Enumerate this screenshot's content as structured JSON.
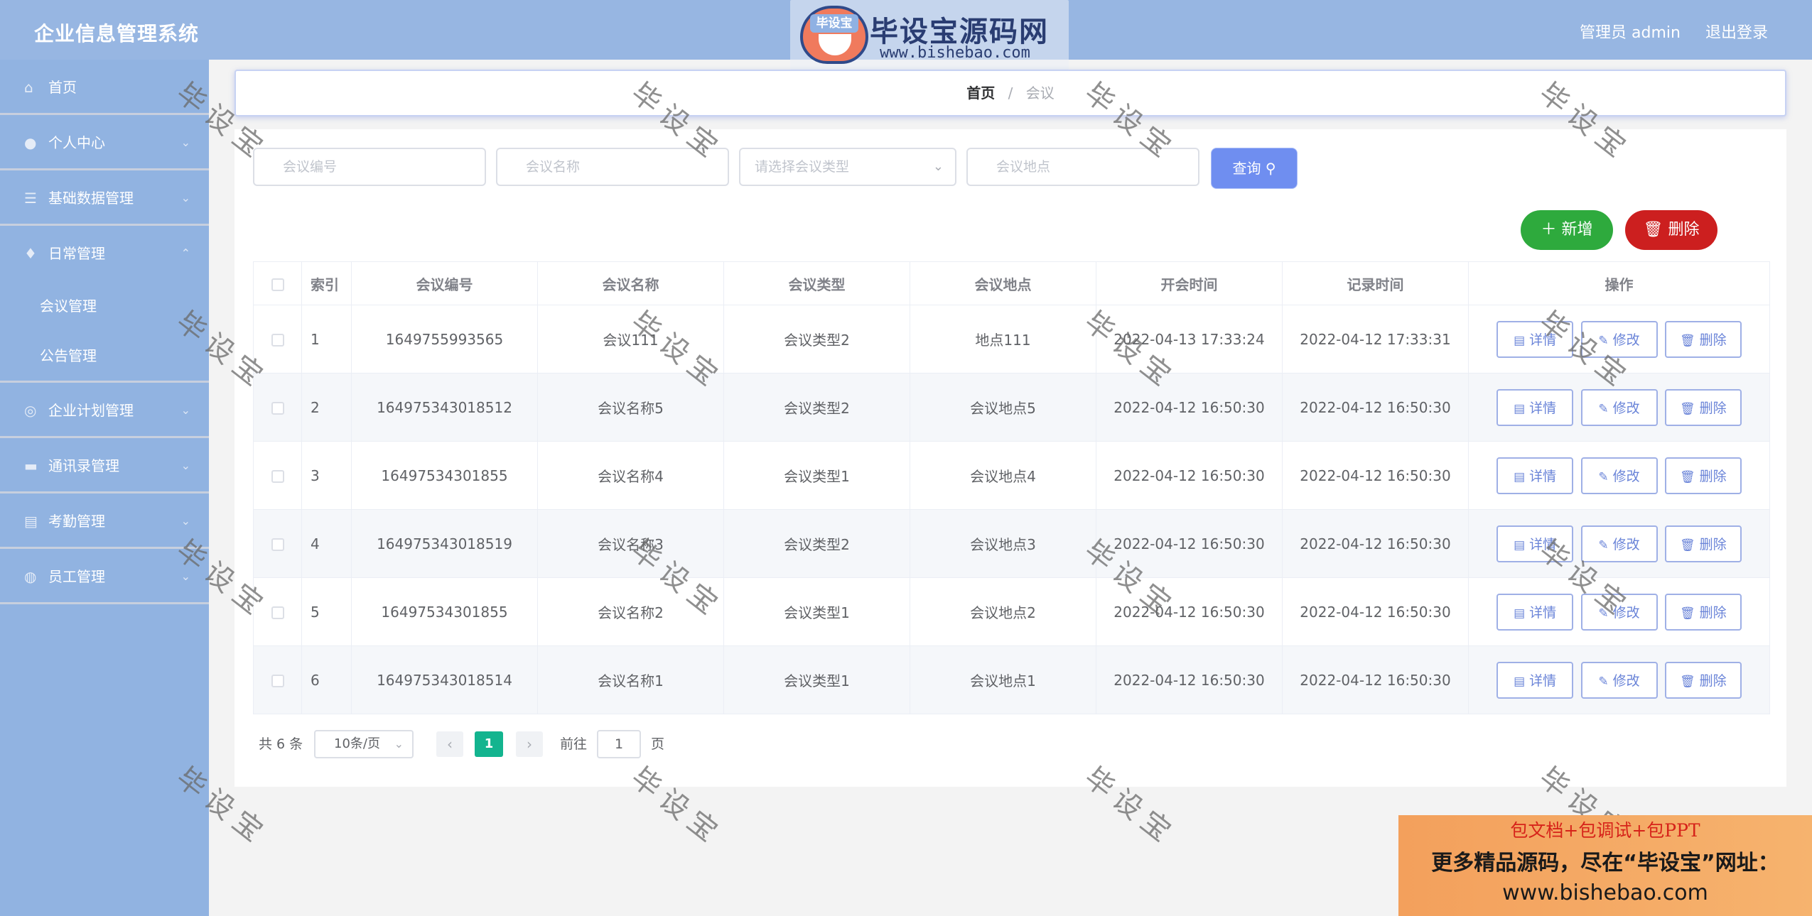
{
  "header": {
    "title": "企业信息管理系统",
    "user": "管理员 admin",
    "logout": "退出登录"
  },
  "logo": {
    "badge": "毕设宝",
    "name": "毕设宝源码网",
    "url": "www.bishebao.com"
  },
  "sidebar": {
    "items": [
      {
        "label": "首页",
        "icon": "home-icon"
      },
      {
        "label": "个人中心",
        "icon": "user-icon"
      },
      {
        "label": "基础数据管理",
        "icon": "sliders-icon"
      },
      {
        "label": "日常管理",
        "icon": "bulb-icon"
      },
      {
        "label": "企业计划管理",
        "icon": "compass-icon"
      },
      {
        "label": "通讯录管理",
        "icon": "briefcase-icon"
      },
      {
        "label": "考勤管理",
        "icon": "clipboard-icon"
      },
      {
        "label": "员工管理",
        "icon": "globe-icon"
      }
    ],
    "sub_items": [
      "会议管理",
      "公告管理"
    ]
  },
  "breadcrumb": {
    "home": "首页",
    "sep": "/",
    "current": "会议"
  },
  "search": {
    "code_placeholder": "会议编号",
    "name_placeholder": "会议名称",
    "type_placeholder": "请选择会议类型",
    "place_placeholder": "会议地点",
    "query_label": "查询"
  },
  "actions": {
    "add_label": "新增",
    "delete_label": "删除"
  },
  "table": {
    "headers": [
      "索引",
      "会议编号",
      "会议名称",
      "会议类型",
      "会议地点",
      "开会时间",
      "记录时间",
      "操作"
    ],
    "row_actions": {
      "detail": "详情",
      "edit": "修改",
      "delete": "删除"
    },
    "rows": [
      {
        "index": "1",
        "code": "1649755993565",
        "name": "会议111",
        "type": "会议类型2",
        "place": "地点111",
        "start": "2022-04-13 17:33:24",
        "record": "2022-04-12 17:33:31"
      },
      {
        "index": "2",
        "code": "164975343018512",
        "name": "会议名称5",
        "type": "会议类型2",
        "place": "会议地点5",
        "start": "2022-04-12 16:50:30",
        "record": "2022-04-12 16:50:30"
      },
      {
        "index": "3",
        "code": "16497534301855",
        "name": "会议名称4",
        "type": "会议类型1",
        "place": "会议地点4",
        "start": "2022-04-12 16:50:30",
        "record": "2022-04-12 16:50:30"
      },
      {
        "index": "4",
        "code": "164975343018519",
        "name": "会议名称3",
        "type": "会议类型2",
        "place": "会议地点3",
        "start": "2022-04-12 16:50:30",
        "record": "2022-04-12 16:50:30"
      },
      {
        "index": "5",
        "code": "16497534301855",
        "name": "会议名称2",
        "type": "会议类型1",
        "place": "会议地点2",
        "start": "2022-04-12 16:50:30",
        "record": "2022-04-12 16:50:30"
      },
      {
        "index": "6",
        "code": "164975343018514",
        "name": "会议名称1",
        "type": "会议类型1",
        "place": "会议地点1",
        "start": "2022-04-12 16:50:30",
        "record": "2022-04-12 16:50:30"
      }
    ]
  },
  "pagination": {
    "total": "共 6 条",
    "page_size": "10条/页",
    "current_page": "1",
    "goto_label": "前往",
    "goto_value": "1",
    "goto_unit": "页",
    "prev": "‹",
    "next": "›"
  },
  "watermark": {
    "text": "毕设宝"
  },
  "promo": {
    "line1": "包文档+包调试+包PPT",
    "line2": "更多精品源码，尽在“毕设宝”网址：",
    "line3": "www.bishebao.com"
  },
  "colors": {
    "header": "#97b6e2",
    "sidebar": "#91b3e1",
    "primary": "#6f8ef0",
    "success": "#2eaa3d",
    "danger": "#cc1f1f",
    "page_active": "#13b48f"
  }
}
